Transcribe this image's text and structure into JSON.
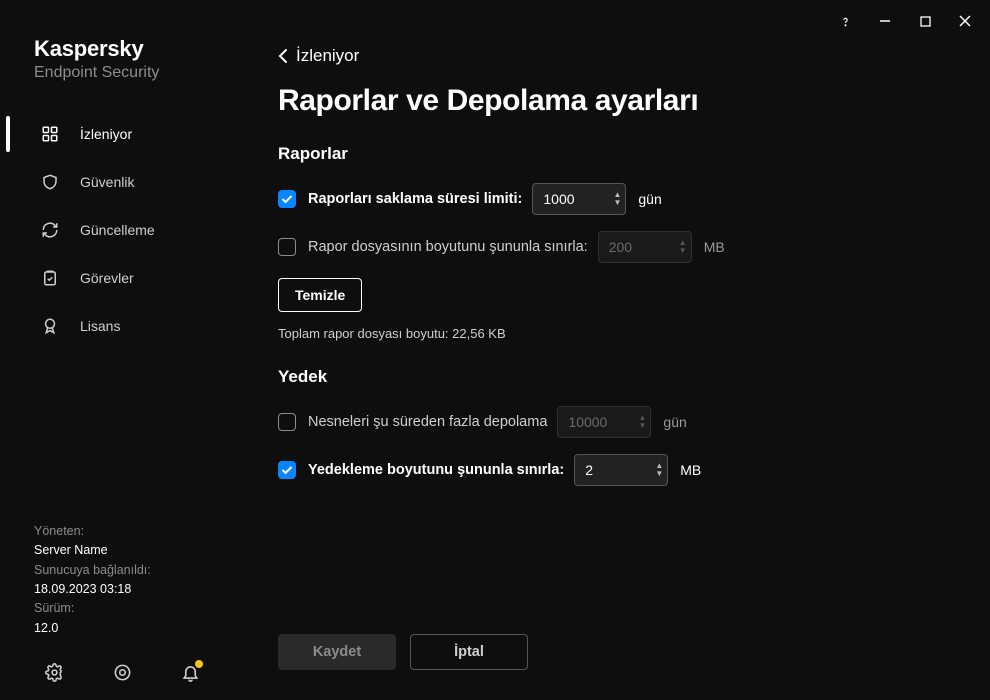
{
  "brand": {
    "name": "Kaspersky",
    "subtitle": "Endpoint Security"
  },
  "nav": {
    "items": [
      {
        "label": "İzleniyor"
      },
      {
        "label": "Güvenlik"
      },
      {
        "label": "Güncelleme"
      },
      {
        "label": "Görevler"
      },
      {
        "label": "Lisans"
      }
    ]
  },
  "status": {
    "managed_by_label": "Yöneten:",
    "server_name": "Server Name",
    "connected_label": "Sunucuya bağlanıldı:",
    "connected_value": "18.09.2023 03:18",
    "version_label": "Sürüm:",
    "version_value": "12.0"
  },
  "back": {
    "label": "İzleniyor"
  },
  "page": {
    "title": "Raporlar ve Depolama ayarları"
  },
  "sections": {
    "reports": {
      "title": "Raporlar",
      "retain_label": "Raporları saklama süresi limiti:",
      "retain_value": "1000",
      "retain_unit": "gün",
      "size_label": "Rapor dosyasının boyutunu şununla sınırla:",
      "size_value": "200",
      "size_unit": "MB",
      "clear_button": "Temizle",
      "total_note": "Toplam rapor dosyası boyutu: 22,56 KB"
    },
    "backup": {
      "title": "Yedek",
      "retain_label": "Nesneleri şu süreden fazla depolama",
      "retain_value": "10000",
      "retain_unit": "gün",
      "size_label": "Yedekleme boyutunu şununla sınırla:",
      "size_value": "2",
      "size_unit": "MB"
    }
  },
  "actions": {
    "save": "Kaydet",
    "cancel": "İptal"
  }
}
